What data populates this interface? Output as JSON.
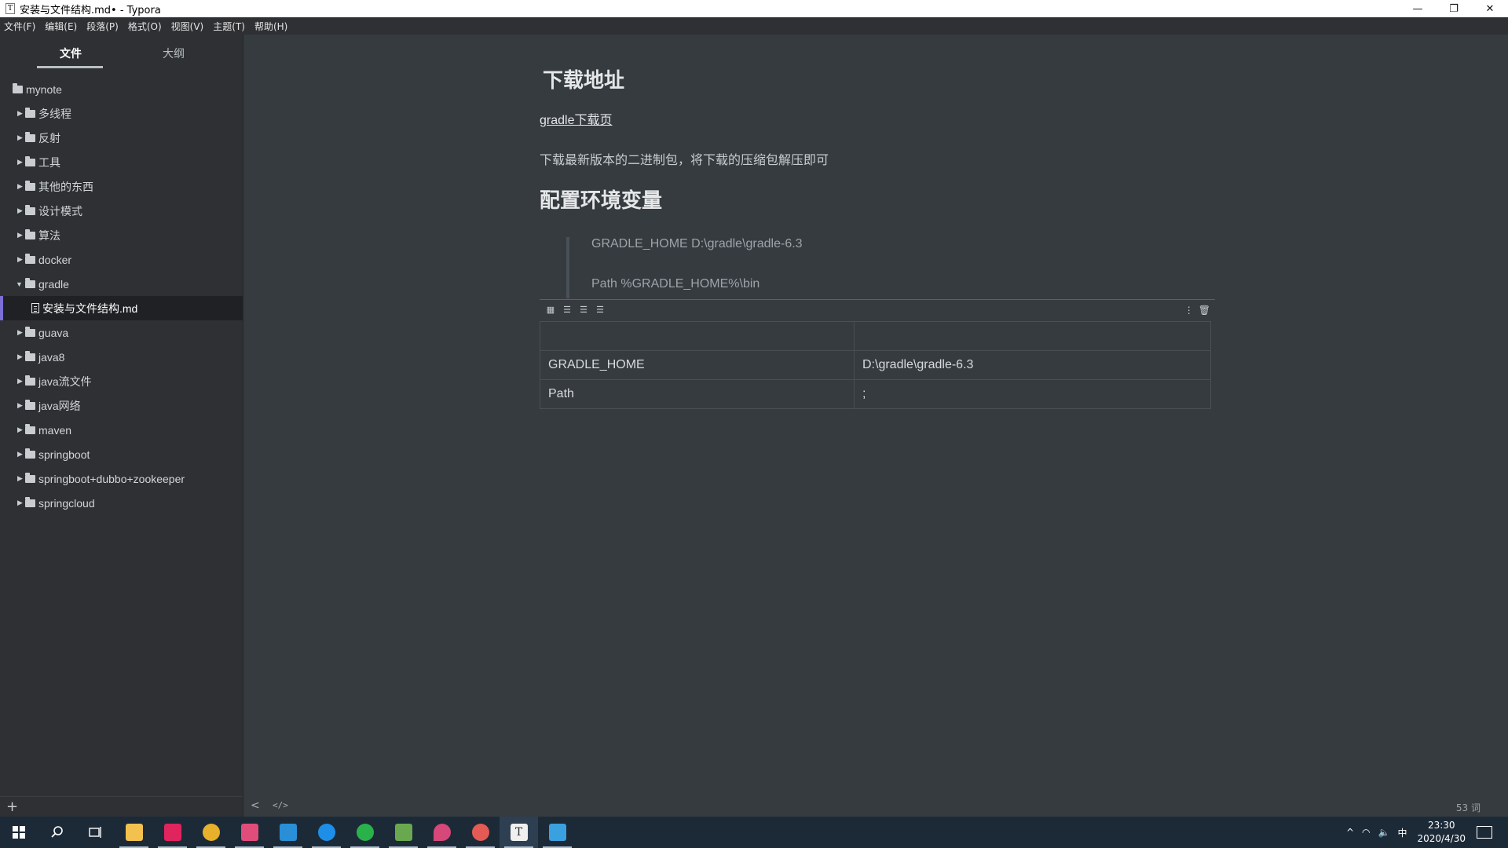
{
  "window": {
    "title": "安装与文件结构.md• - Typora",
    "app_icon_letter": "T",
    "minimize_glyph": "—",
    "restore_glyph": "❐",
    "close_glyph": "✕"
  },
  "menu": [
    "文件(F)",
    "编辑(E)",
    "段落(P)",
    "格式(O)",
    "视图(V)",
    "主题(T)",
    "帮助(H)"
  ],
  "sidebar": {
    "tabs": [
      "文件",
      "大纲"
    ],
    "active_tab": "文件",
    "root": "mynote",
    "items": [
      {
        "label": "多线程",
        "type": "folder"
      },
      {
        "label": "反射",
        "type": "folder"
      },
      {
        "label": "工具",
        "type": "folder"
      },
      {
        "label": "其他的东西",
        "type": "folder"
      },
      {
        "label": "设计模式",
        "type": "folder"
      },
      {
        "label": "算法",
        "type": "folder"
      },
      {
        "label": "docker",
        "type": "folder"
      },
      {
        "label": "gradle",
        "type": "folder",
        "expanded": true
      },
      {
        "label": "安装与文件结构.md",
        "type": "file",
        "selected": true
      },
      {
        "label": "guava",
        "type": "folder"
      },
      {
        "label": "java8",
        "type": "folder"
      },
      {
        "label": "java流文件",
        "type": "folder"
      },
      {
        "label": "java网络",
        "type": "folder"
      },
      {
        "label": "maven",
        "type": "folder"
      },
      {
        "label": "springboot",
        "type": "folder"
      },
      {
        "label": "springboot+dubbo+zookeeper",
        "type": "folder"
      },
      {
        "label": "springcloud",
        "type": "folder"
      }
    ],
    "add_label": "+"
  },
  "document": {
    "heading1": "下载地址",
    "link_text": "gradle下载页",
    "paragraph": "下载最新版本的二进制包，将下载的压缩包解压即可",
    "heading2": "配置环境变量",
    "quote_lines": [
      "GRADLE_HOME  D:\\gradle\\gradle-6.3",
      "Path  %GRADLE_HOME%\\bin"
    ],
    "table": {
      "header": [
        "",
        ""
      ],
      "rows": [
        [
          "GRADLE_HOME",
          "D:\\gradle\\gradle-6.3"
        ],
        [
          "Path",
          ";"
        ]
      ]
    }
  },
  "footer": {
    "back_glyph": "<",
    "source_glyph": "</>",
    "word_count": "53 词"
  },
  "taskbar": {
    "apps": [
      {
        "name": "search",
        "color": "#1c2a38"
      },
      {
        "name": "task-view",
        "color": "#1c2a38"
      },
      {
        "name": "file-explorer",
        "color": "#f2c14e"
      },
      {
        "name": "intellij",
        "color": "#e0245e"
      },
      {
        "name": "chrome",
        "color": "#e8b12b"
      },
      {
        "name": "sublime",
        "color": "#e04d7a"
      },
      {
        "name": "vscode",
        "color": "#2a8fd6"
      },
      {
        "name": "thunder",
        "color": "#1e8fe8"
      },
      {
        "name": "wechat-like",
        "color": "#2ab24a"
      },
      {
        "name": "plant-app",
        "color": "#6aa84f"
      },
      {
        "name": "drop-app",
        "color": "#d6477a"
      },
      {
        "name": "weibo",
        "color": "#e45a55"
      },
      {
        "name": "typora",
        "color": "#f0f0f0"
      },
      {
        "name": "remote-desktop",
        "color": "#3aa0e0"
      }
    ],
    "tray": {
      "chevron": "^",
      "network": "◠",
      "volume": "🔈",
      "ime": "中",
      "time": "23:30",
      "date": "2020/4/30"
    }
  }
}
